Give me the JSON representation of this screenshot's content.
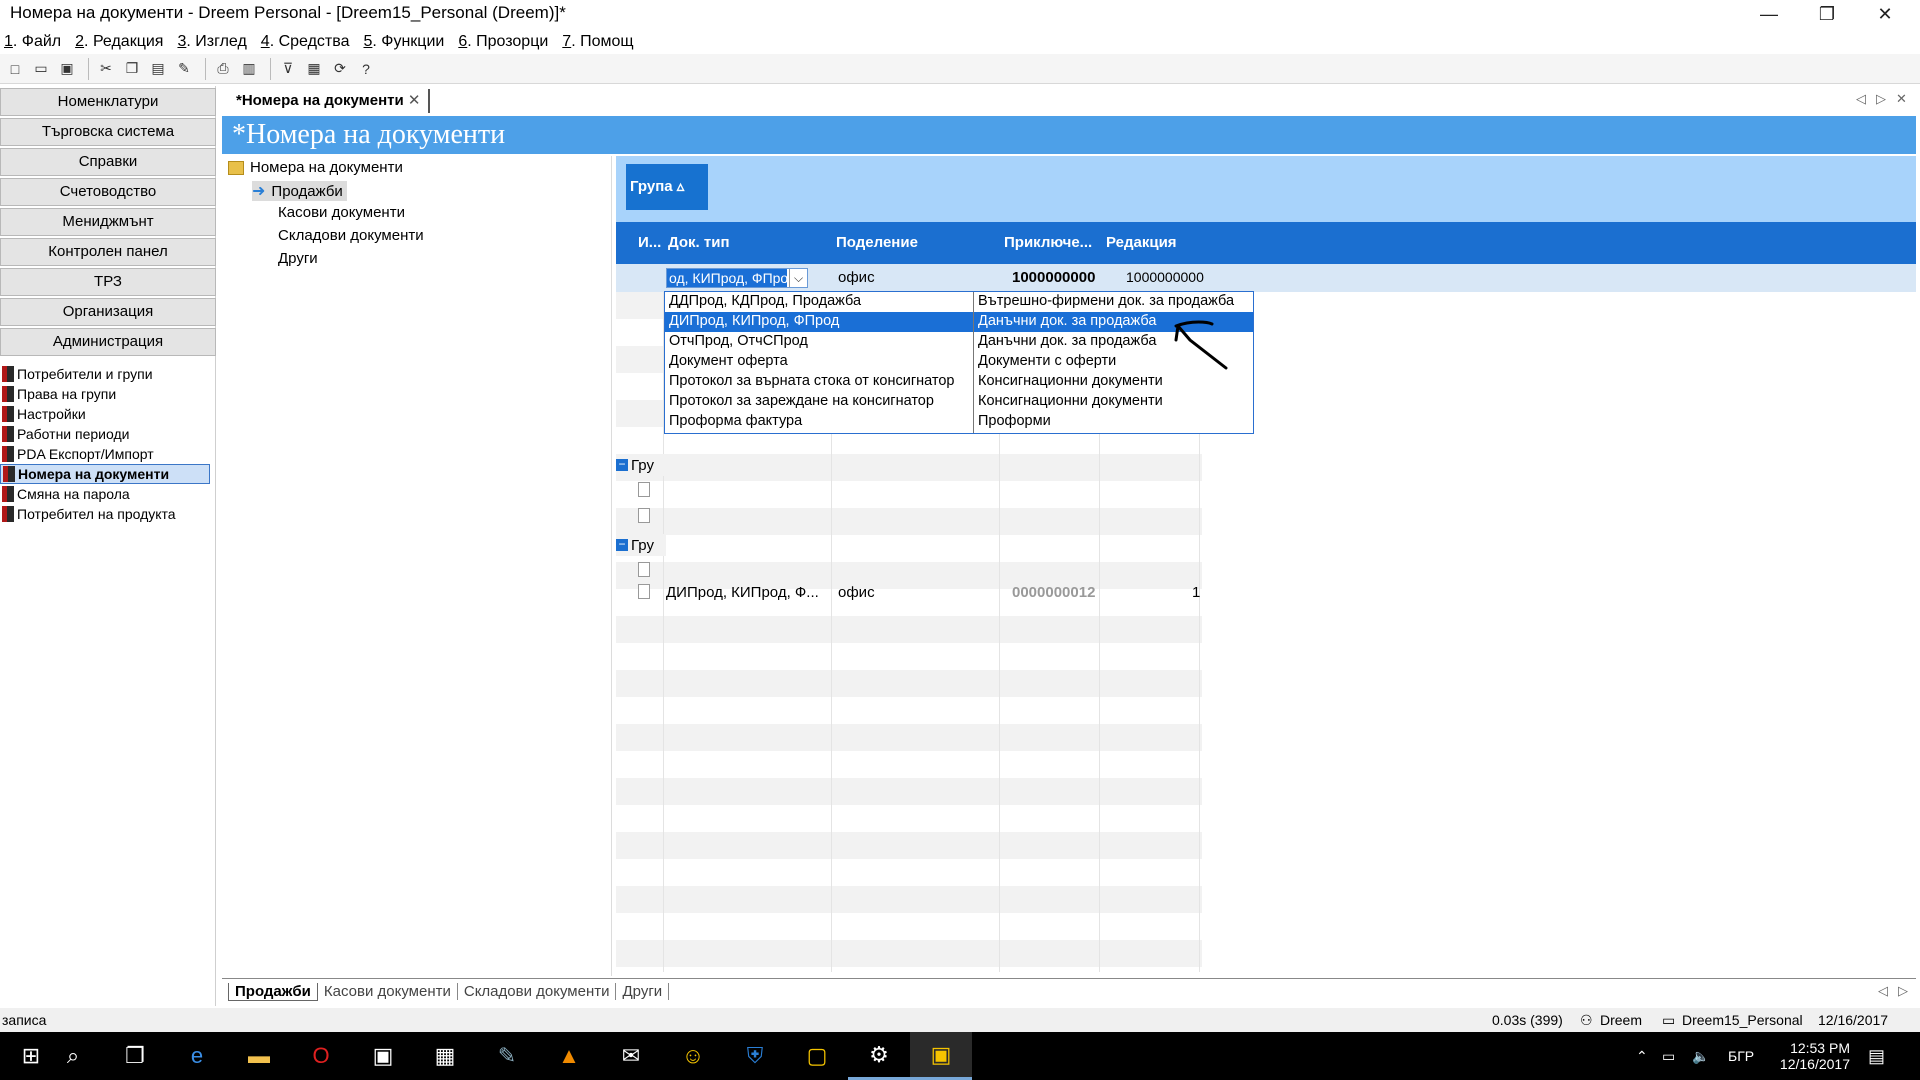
{
  "window": {
    "title": "Номера на документи - Dreem Personal - [Dreem15_Personal (Dreem)]*",
    "minimize": "—",
    "restore": "❐",
    "close": "✕"
  },
  "menu": [
    {
      "key": "1",
      "label": ". Файл"
    },
    {
      "key": "2",
      "label": ". Редакция"
    },
    {
      "key": "3",
      "label": ". Изглед"
    },
    {
      "key": "4",
      "label": ". Средства"
    },
    {
      "key": "5",
      "label": ". Функции"
    },
    {
      "key": "6",
      "label": ". Прозорци"
    },
    {
      "key": "7",
      "label": ". Помощ"
    }
  ],
  "leftnav": {
    "buttons": [
      "Номенклатури",
      "Търговска система",
      "Справки",
      "Счетоводство",
      "Мениджмънт",
      "Контролен панел",
      "ТРЗ",
      "Организация",
      "Администрация"
    ],
    "items": [
      "Потребители и групи",
      "Права на групи",
      "Настройки",
      "Работни периоди",
      "PDA Експорт/Импорт",
      "Номера на документи",
      "Смяна на парола",
      "Потребител на продукта"
    ]
  },
  "tab": {
    "label": "*Номера на документи",
    "close": "✕",
    "prev": "◁",
    "next": "▷",
    "x": "✕"
  },
  "header": {
    "title": "*Номера на документи"
  },
  "tree": {
    "root": "Номера на документи",
    "children": [
      "Продажби",
      "Касови документи",
      "Складови документи",
      "Други"
    ]
  },
  "grid": {
    "group_button": "Група ▵",
    "columns": [
      "И...",
      "Док. тип",
      "Поделение",
      "Приключе...",
      "Редакция"
    ],
    "filter": {
      "doc_type": "од, КИПрод, ФПрод",
      "division": "офис",
      "closing": "1000000000",
      "edit": "1000000000"
    },
    "group_label": "Гру",
    "visible_row": {
      "doc_type": "ДИПрод, КИПрод, Ф...",
      "division": "офис",
      "closing": "0000000012",
      "edit": "1"
    }
  },
  "dropdown": {
    "rows": [
      {
        "code": "ДДПрод, КДПрод, Продажба",
        "name": "Вътрешно-фирмени док. за продажба"
      },
      {
        "code": "ДИПрод, КИПрод, ФПрод",
        "name": "Данъчни док. за продажба"
      },
      {
        "code": "ОтчПрод, ОтчСПрод",
        "name": "Данъчни док. за продажба"
      },
      {
        "code": "Документ оферта",
        "name": "Документи с оферти"
      },
      {
        "code": "Протокол за върната стока от консигнатор",
        "name": "Консигнационни документи"
      },
      {
        "code": "Протокол за зареждане на консигнатор",
        "name": "Консигнационни документи"
      },
      {
        "code": "Проформа фактура",
        "name": "Проформи"
      }
    ],
    "selected_index": 1
  },
  "bottom_tabs": [
    "Продажби",
    "Касови документи",
    "Складови документи",
    "Други"
  ],
  "statusbar": {
    "left": "записа",
    "timing": "0.03s (399)",
    "user": "Dreem",
    "db": "Dreem15_Personal",
    "date": "12/16/2017"
  },
  "taskbar": {
    "time": "12:53 PM",
    "date": "12/16/2017",
    "lang": "БГР"
  }
}
